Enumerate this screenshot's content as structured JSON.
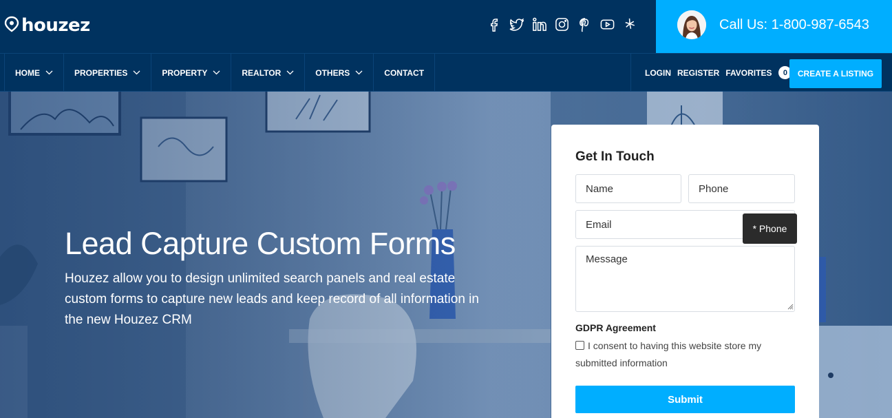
{
  "brand": {
    "logo_text": "houzez"
  },
  "header": {
    "social_icons": [
      "facebook-icon",
      "twitter-icon",
      "linkedin-icon",
      "instagram-icon",
      "pinterest-icon",
      "youtube-icon",
      "yelp-icon"
    ],
    "call_text": "Call Us: 1-800-987-6543"
  },
  "nav": {
    "items": [
      {
        "label": "HOME",
        "dropdown": true
      },
      {
        "label": "PROPERTIES",
        "dropdown": true
      },
      {
        "label": "PROPERTY",
        "dropdown": true
      },
      {
        "label": "REALTOR",
        "dropdown": true
      },
      {
        "label": "OTHERS",
        "dropdown": true
      },
      {
        "label": "CONTACT",
        "dropdown": false
      }
    ],
    "login": "LOGIN",
    "register": "REGISTER",
    "favorites": "FAVORITES",
    "favorites_count": "0",
    "create_listing": "CREATE A LISTING"
  },
  "hero": {
    "title": "Lead Capture Custom Forms",
    "description": "Houzez allow you to design unlimited search panels and real estate custom forms to capture new leads and keep record of all information in the new Houzez CRM"
  },
  "form": {
    "title": "Get In Touch",
    "name_placeholder": "Name",
    "phone_placeholder": "Phone",
    "email_placeholder": "Email",
    "message_placeholder": "Message",
    "tooltip": "* Phone",
    "gdpr_title": "GDPR Agreement",
    "consent": "I consent to having this website store my submitted information",
    "consent_checked": false,
    "submit": "Submit"
  },
  "colors": {
    "navy": "#00325f",
    "accent": "#00aeff",
    "tooltip": "#2b2b2b"
  }
}
